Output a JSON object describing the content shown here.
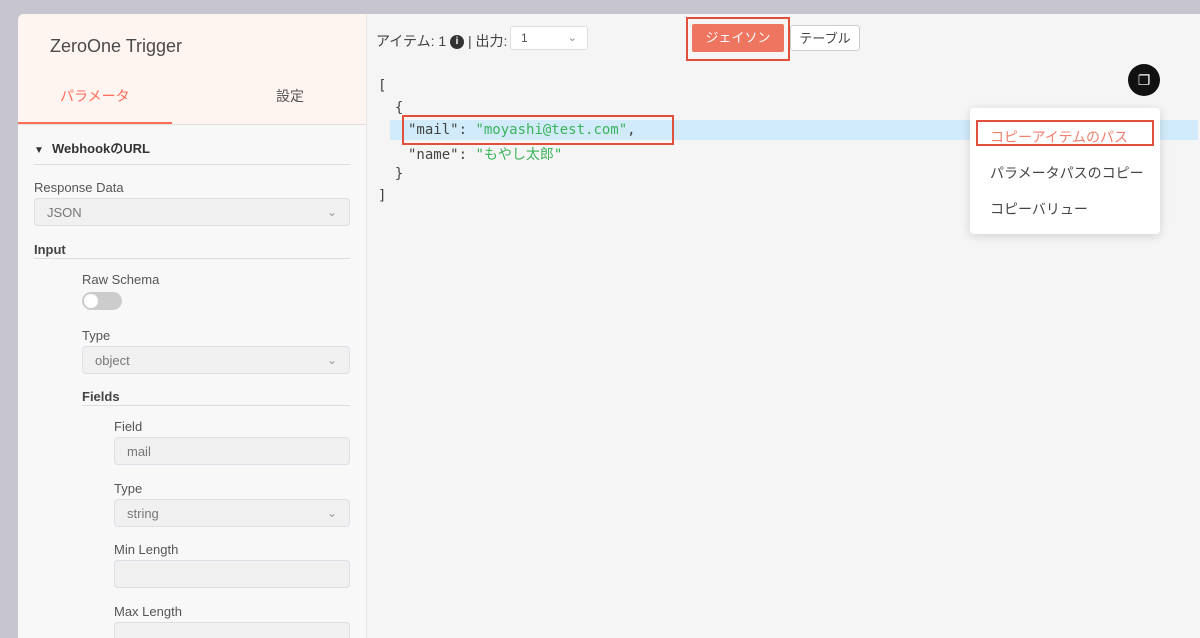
{
  "node": {
    "title": "ZeroOne Trigger",
    "tabs": [
      "パラメータ",
      "設定"
    ]
  },
  "params": {
    "section_title": "WebhookのURL",
    "response_data_label": "Response Data",
    "response_data_value": "JSON",
    "input_label": "Input",
    "raw_schema_label": "Raw Schema",
    "type_label": "Type",
    "type_value": "object",
    "fields_label": "Fields",
    "field_label": "Field",
    "field_value": "mail",
    "field_type_label": "Type",
    "field_type_value": "string",
    "min_length_label": "Min Length",
    "min_length_value": "",
    "max_length_label": "Max Length"
  },
  "output": {
    "items_label": "アイテム: 1",
    "info_icon": "i",
    "separator": "|",
    "output_label": "出力:",
    "output_select": "1",
    "view_json": "ジェイソン",
    "view_table": "テーブル"
  },
  "json_lines": [
    "[",
    "  {",
    "\"mail\": ",
    "\"moyashi@test.com\"",
    ",",
    "\"name\": ",
    "\"もやし太郎\"",
    "  }",
    "]"
  ],
  "copy_menu": {
    "items": [
      "コピーアイテムのパス",
      "パラメータパスのコピー",
      "コピーバリュー"
    ]
  },
  "colors": {
    "accent": "#ff6d5a",
    "json_button": "#ee7661",
    "annotation_red": "#e0503a",
    "string_green": "#3bb35b",
    "row_highlight": "#d2ebfa"
  }
}
